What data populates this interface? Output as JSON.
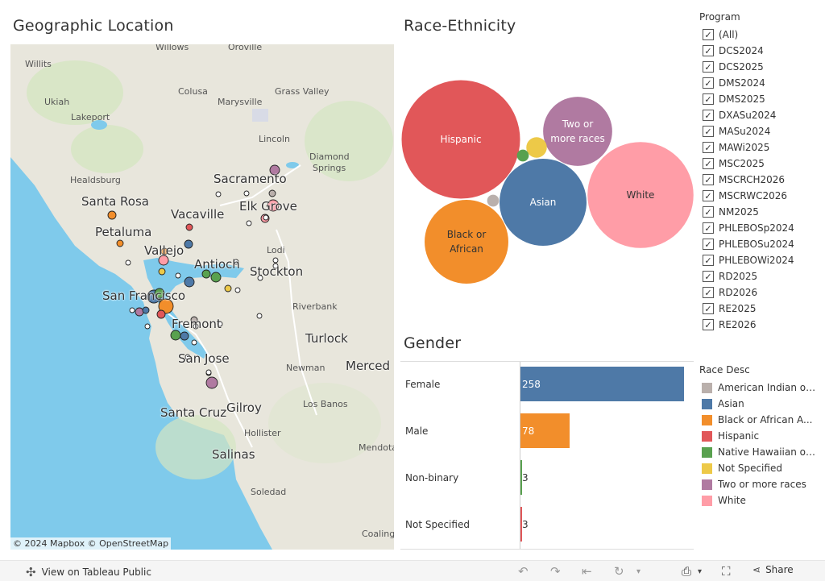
{
  "titles": {
    "geo": "Geographic Location",
    "race": "Race-Ethnicity",
    "gender": "Gender"
  },
  "map": {
    "attribution": "© 2024 Mapbox  © OpenStreetMap",
    "places_small": [
      "Willits",
      "Willows",
      "Oroville",
      "Ukiah",
      "Colusa",
      "Grass Valley",
      "Marysville",
      "Lakeport",
      "Lincoln",
      "Diamond",
      "Springs",
      "Healdsburg",
      "Lodi",
      "Riverbank",
      "Newman",
      "Los Banos",
      "Hollister",
      "Soledad",
      "Mendota",
      "Coaling"
    ],
    "places_large": [
      "Sacramento",
      "Santa Rosa",
      "Vacaville",
      "Elk Grove",
      "Petaluma",
      "Vallejo",
      "Antioch",
      "Stockton",
      "San Francisco",
      "Fremont",
      "Turlock",
      "Merced",
      "San Jose",
      "Gilroy",
      "Santa Cruz",
      "Salinas"
    ]
  },
  "program_filter": {
    "title": "Program",
    "items": [
      "(All)",
      "DCS2024",
      "DCS2025",
      "DMS2024",
      "DMS2025",
      "DXASu2024",
      "MASu2024",
      "MAWi2025",
      "MSC2025",
      "MSCRCH2026",
      "MSCRWC2026",
      "NM2025",
      "PHLEBOSp2024",
      "PHLEBOSu2024",
      "PHLEBOWi2024",
      "RD2025",
      "RD2026",
      "RE2025",
      "RE2026"
    ]
  },
  "legend": {
    "title": "Race Desc",
    "items": [
      {
        "label": "American Indian or...",
        "color": "#bab0ac"
      },
      {
        "label": "Asian",
        "color": "#4e79a7"
      },
      {
        "label": "Black or African A...",
        "color": "#f28e2b"
      },
      {
        "label": "Hispanic",
        "color": "#e15759"
      },
      {
        "label": "Native Hawaiian or...",
        "color": "#59a14f"
      },
      {
        "label": "Not Specified",
        "color": "#edc948"
      },
      {
        "label": "Two or more races",
        "color": "#b07aa1"
      },
      {
        "label": "White",
        "color": "#ff9da7"
      }
    ]
  },
  "chart_data": [
    {
      "type": "bubble",
      "title": "Race-Ethnicity",
      "series": [
        {
          "name": "Hispanic",
          "label": "Hispanic",
          "value": 100,
          "color": "#e15759"
        },
        {
          "name": "White",
          "label": "White",
          "value": 80,
          "color": "#ff9da7"
        },
        {
          "name": "Black or African American",
          "label": "Black or|African",
          "value": 50,
          "color": "#f28e2b"
        },
        {
          "name": "Asian",
          "label": "Asian",
          "value": 54,
          "color": "#4e79a7"
        },
        {
          "name": "Two or more races",
          "label": "Two or|more races",
          "value": 34,
          "color": "#b07aa1"
        },
        {
          "name": "Not Specified",
          "label": "",
          "value": 3,
          "color": "#edc948"
        },
        {
          "name": "Native Hawaiian or Other Pacific Islander",
          "label": "",
          "value": 1,
          "color": "#59a14f"
        },
        {
          "name": "American Indian or Alaska Native",
          "label": "",
          "value": 1,
          "color": "#bab0ac"
        }
      ]
    },
    {
      "type": "bar",
      "title": "Gender",
      "categories": [
        "Female",
        "Male",
        "Non-binary",
        "Not Specified"
      ],
      "values": [
        258,
        78,
        3,
        3
      ],
      "colors": [
        "#4e79a7",
        "#f28e2b",
        "#59a14f",
        "#e15759"
      ]
    }
  ],
  "footer": {
    "view_label": "View on Tableau Public",
    "share_label": "Share"
  }
}
